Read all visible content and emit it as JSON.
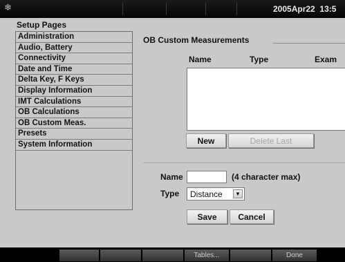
{
  "status_bar": {
    "date": "2005Apr22",
    "time": "13:5"
  },
  "setup": {
    "title": "Setup Pages",
    "items": [
      {
        "label": "Administration"
      },
      {
        "label": "Audio, Battery"
      },
      {
        "label": "Connectivity"
      },
      {
        "label": "Date and Time"
      },
      {
        "label": "Delta Key, F Keys"
      },
      {
        "label": "Display Information"
      },
      {
        "label": "IMT Calculations"
      },
      {
        "label": "OB Calculations"
      },
      {
        "label": "OB Custom Meas."
      },
      {
        "label": "Presets"
      },
      {
        "label": "System Information"
      }
    ]
  },
  "ob_custom": {
    "title": "OB Custom Measurements",
    "columns": {
      "name": "Name",
      "type": "Type",
      "exam": "Exam"
    },
    "rows": [],
    "new_label": "New",
    "delete_last_label": "Delete Last"
  },
  "form": {
    "name_label": "Name",
    "name_value": "",
    "name_hint": "(4 character max)",
    "type_label": "Type",
    "type_value": "Distance",
    "save_label": "Save",
    "cancel_label": "Cancel"
  },
  "softkeys": {
    "tables_label": "Tables...",
    "done_label": "Done"
  }
}
